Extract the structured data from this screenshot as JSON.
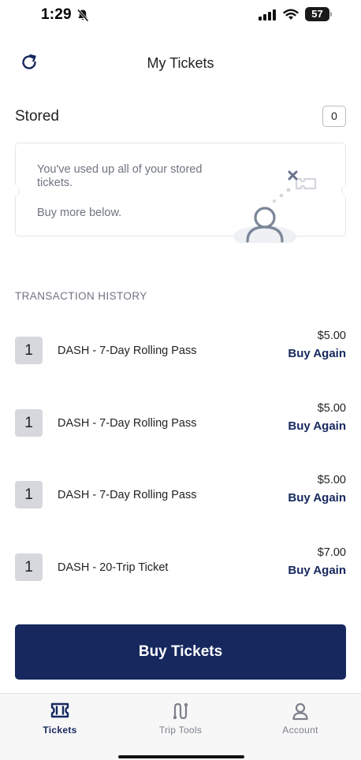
{
  "status_bar": {
    "time": "1:29",
    "battery_level": "57",
    "icons": [
      "bell-slash-icon",
      "signal-icon",
      "wifi-icon",
      "battery-icon"
    ]
  },
  "header": {
    "title": "My Tickets",
    "refresh_icon": "refresh-icon"
  },
  "stored": {
    "label": "Stored",
    "count": "0",
    "empty_message": "You've used up all of your stored tickets.",
    "empty_submessage": "Buy more below.",
    "illustration_icon": "person-with-ticket-icon"
  },
  "history": {
    "heading": "TRANSACTION HISTORY",
    "rows": [
      {
        "qty": "1",
        "name": "DASH - 7-Day Rolling Pass",
        "price": "$5.00",
        "action": "Buy Again"
      },
      {
        "qty": "1",
        "name": "DASH - 7-Day Rolling Pass",
        "price": "$5.00",
        "action": "Buy Again"
      },
      {
        "qty": "1",
        "name": "DASH - 7-Day Rolling Pass",
        "price": "$5.00",
        "action": "Buy Again"
      },
      {
        "qty": "1",
        "name": "DASH - 20-Trip Ticket",
        "price": "$7.00",
        "action": "Buy Again"
      }
    ]
  },
  "primary_action": {
    "label": "Buy Tickets"
  },
  "tab_bar": {
    "tabs": [
      {
        "label": "Tickets",
        "icon": "ticket-icon",
        "active": true
      },
      {
        "label": "Trip Tools",
        "icon": "route-icon",
        "active": false
      },
      {
        "label": "Account",
        "icon": "person-icon",
        "active": false
      }
    ]
  },
  "colors": {
    "brand_navy": "#17285e",
    "muted_text": "#6f7480",
    "qty_badge": "#d6d8dd"
  }
}
